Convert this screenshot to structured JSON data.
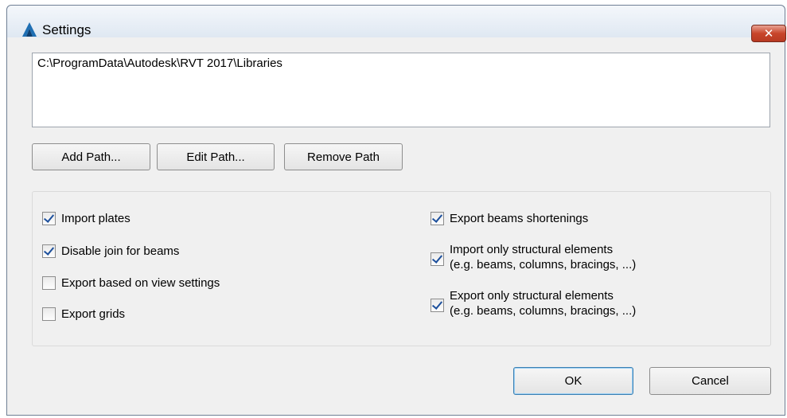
{
  "window": {
    "title": "Settings",
    "close_glyph": "✕",
    "app_icon": "autodesk-a-icon"
  },
  "paths": {
    "items": [
      "C:\\ProgramData\\Autodesk\\RVT 2017\\Libraries"
    ]
  },
  "path_buttons": {
    "add": "Add Path...",
    "edit": "Edit Path...",
    "remove": "Remove Path"
  },
  "options": {
    "import_plates": {
      "label": "Import plates",
      "checked": true
    },
    "disable_join": {
      "label": "Disable join for beams",
      "checked": true
    },
    "export_view_settings": {
      "label": "Export based on view settings",
      "checked": false
    },
    "export_grids": {
      "label": "Export grids",
      "checked": false
    },
    "export_shortenings": {
      "label": "Export beams shortenings",
      "checked": true
    },
    "import_structural": {
      "label": "Import only structural elements",
      "sub": "(e.g. beams, columns, bracings, ...)",
      "checked": true
    },
    "export_structural": {
      "label": "Export only structural elements",
      "sub": "(e.g. beams, columns, bracings, ...)",
      "checked": true
    }
  },
  "footer": {
    "ok": "OK",
    "cancel": "Cancel"
  },
  "colors": {
    "close_red": "#c8452a",
    "check_blue": "#1c4f9c",
    "ok_border": "#3c7fb1"
  }
}
